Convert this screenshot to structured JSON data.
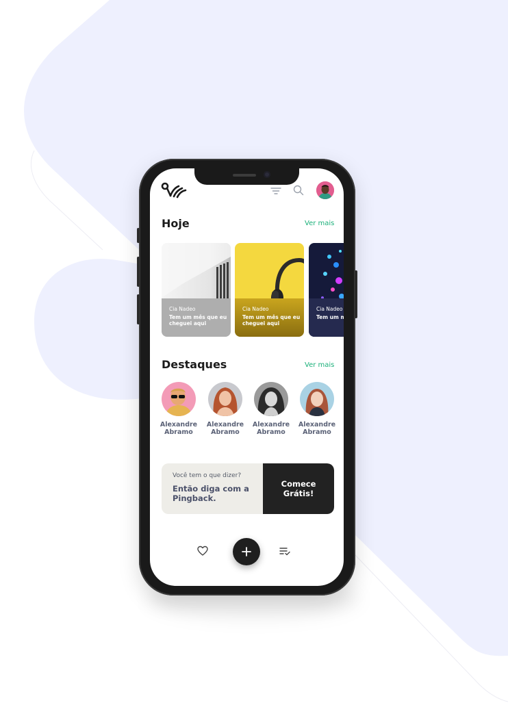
{
  "colors": {
    "background_shape": "#eef0fe",
    "accent_green": "#1bb07a",
    "dark": "#1f1f1f",
    "promo_bg": "#eeede8"
  },
  "header": {
    "logo": "app-logo-icon",
    "icons": [
      "filter-icon",
      "search-icon",
      "user-avatar"
    ]
  },
  "today": {
    "title": "Hoje",
    "see_more": "Ver mais",
    "cards": [
      {
        "subtitle": "Cia Nadeo",
        "title": "Tem um mês que eu cheguei aqui"
      },
      {
        "subtitle": "Cia Nadeo",
        "title": "Tem um mês que eu cheguei aqui"
      },
      {
        "subtitle": "Cia Nadeo",
        "title": "Tem um m eu chegu"
      }
    ]
  },
  "highlights": {
    "title": "Destaques",
    "see_more": "Ver mais",
    "people": [
      {
        "name": "Alexandre Abramo"
      },
      {
        "name": "Alexandre Abramo"
      },
      {
        "name": "Alexandre Abramo"
      },
      {
        "name": "Alexandre Abramo"
      }
    ]
  },
  "promo": {
    "small_text": "Você tem o que dizer?",
    "big_text": "Então diga com a Pingback.",
    "cta_label": "Comece Grátis!"
  },
  "bottom_nav": {
    "items": [
      "heart-icon",
      "add-icon",
      "playlist-check-icon"
    ]
  }
}
